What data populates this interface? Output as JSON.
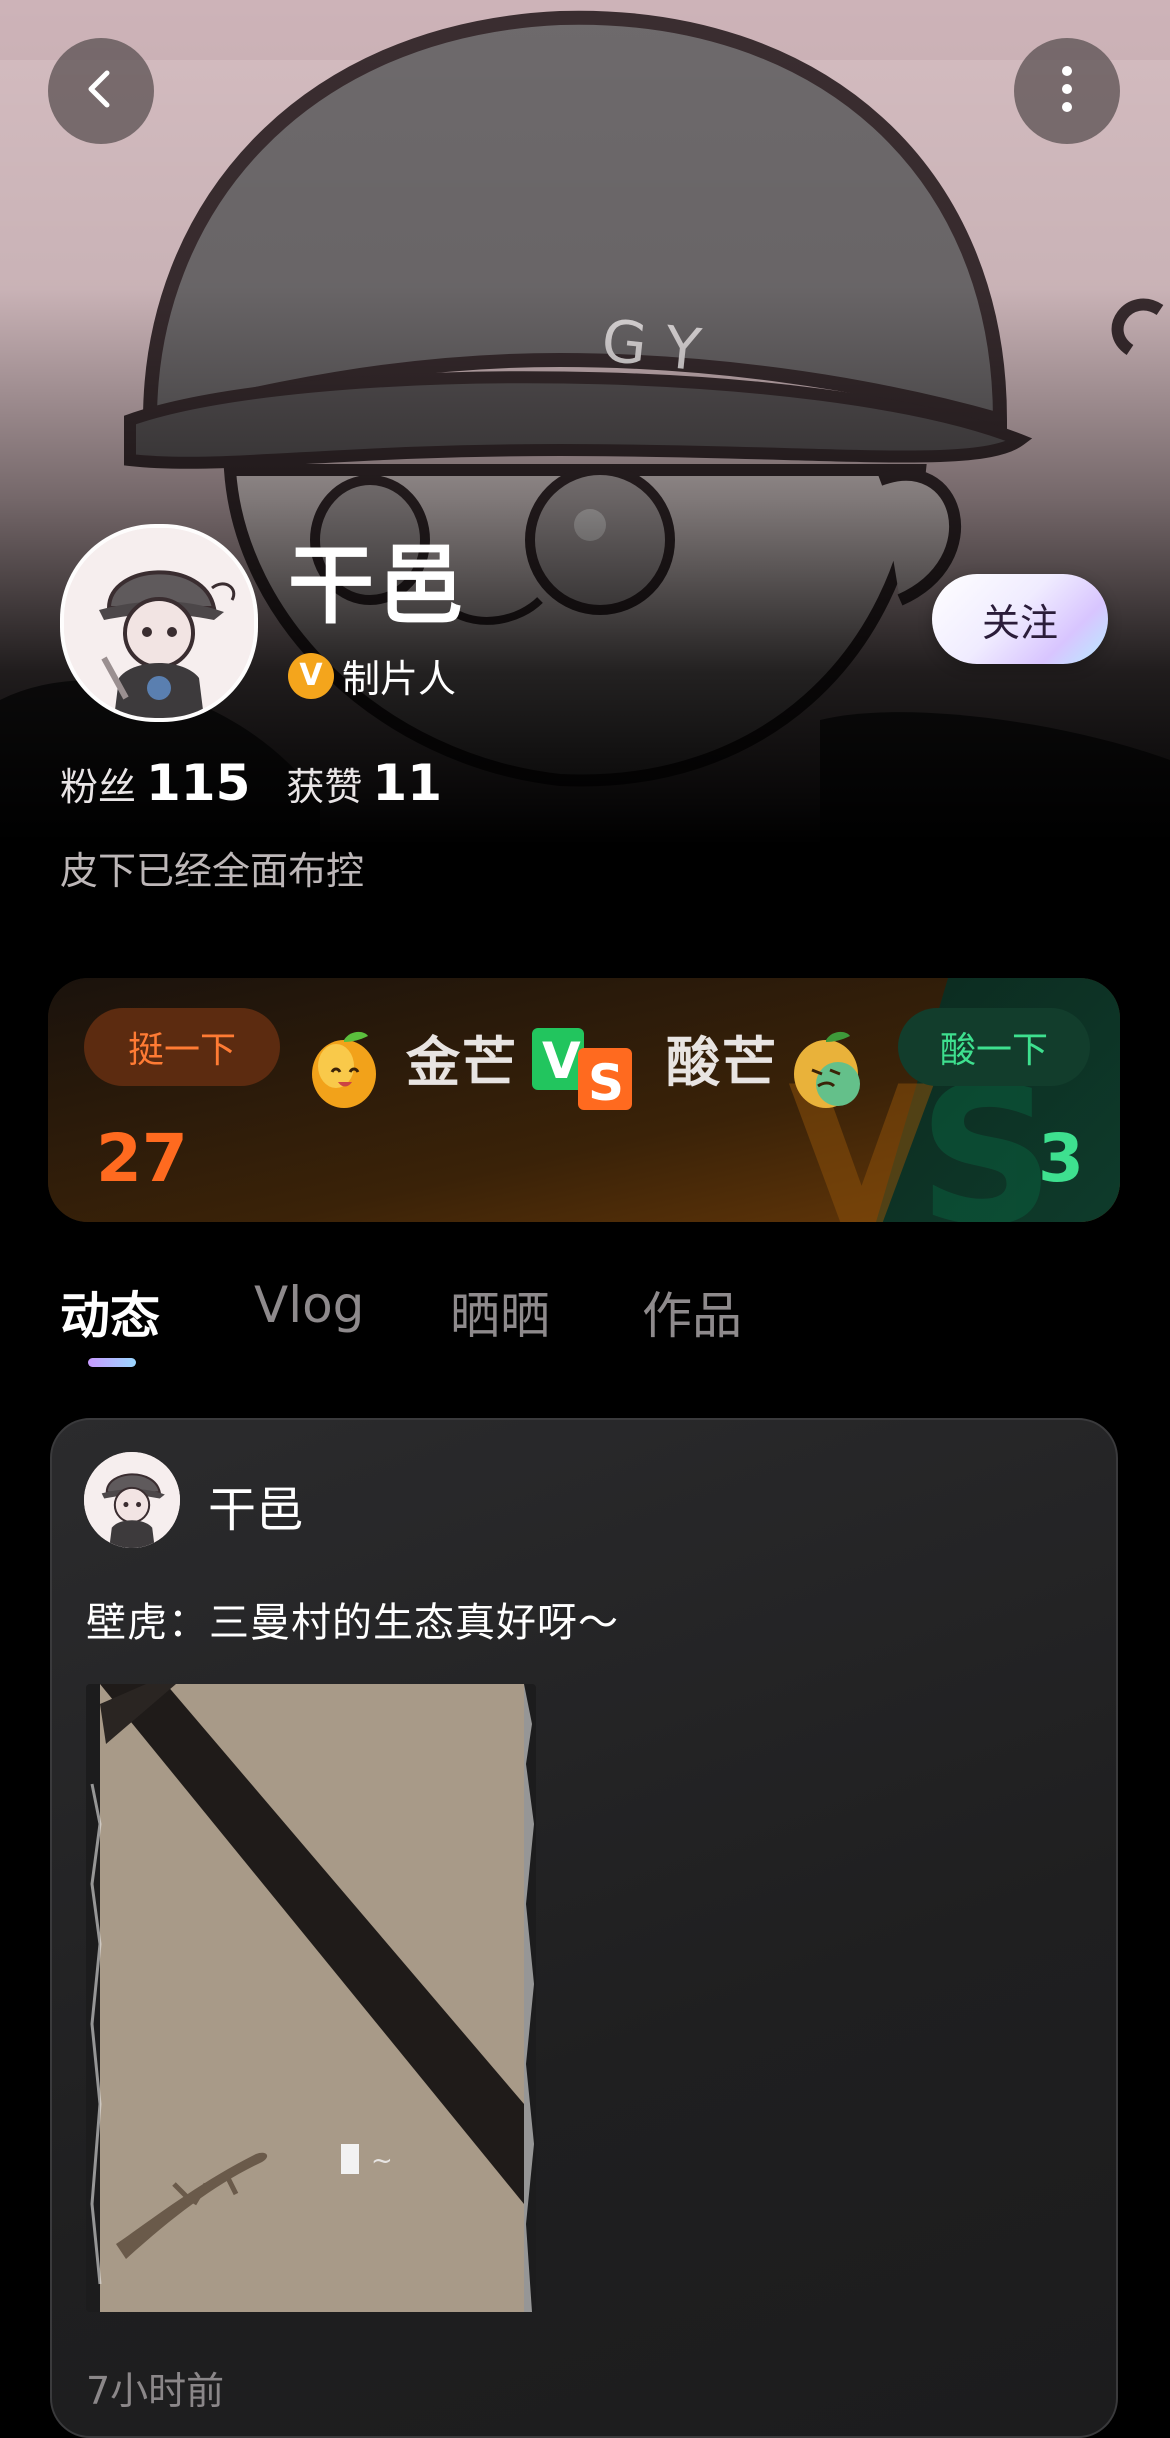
{
  "header": {
    "back_icon": "chevron-left-icon",
    "more_icon": "more-vertical-icon"
  },
  "profile": {
    "name": "干邑",
    "verified_badge": "V",
    "role": "制片人",
    "follow_label": "关注",
    "followers_label": "粉丝",
    "followers_count": "115",
    "likes_label": "获赞",
    "likes_count": "11",
    "bio": "皮下已经全面布控"
  },
  "vs_card": {
    "left_button": "挺一下",
    "left_name": "金芒",
    "left_count": "27",
    "vs_v": "V",
    "vs_s": "S",
    "right_name": "酸芒",
    "right_button": "酸一下",
    "right_count": "3",
    "left_color": "#ff6a1f",
    "right_color": "#3ee08f"
  },
  "tabs": {
    "items": [
      "动态",
      "Vlog",
      "晒晒",
      "作品"
    ],
    "active_index": 0
  },
  "post": {
    "author": "干邑",
    "text": "壁虎：三曼村的生态真好呀～",
    "time": "7小时前"
  }
}
